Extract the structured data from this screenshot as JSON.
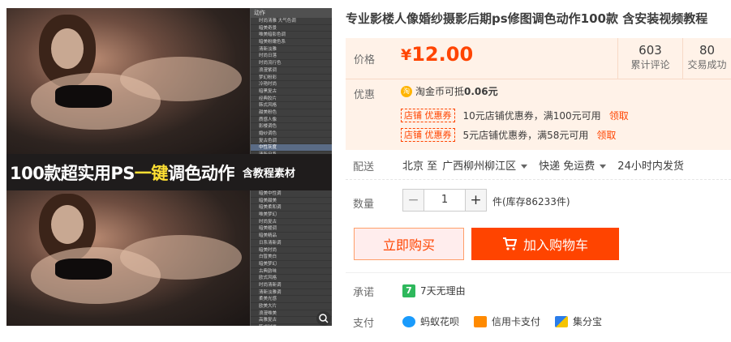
{
  "gallery": {
    "banner_prefix": "100款超实用PS",
    "banner_highlight": "一键",
    "banner_suffix": "调色动作",
    "banner_sub": "含教程素材",
    "panel_title": "动作",
    "panel_rows_top": [
      "时尚清雅 大气色调",
      "暗美奇景",
      "唯美暗影色调",
      "暗美粉嫩色系",
      "清新淡雅",
      "时尚日落",
      "时尚流行色",
      "浪漫紫调",
      "梦幻粉彩",
      "冷艳时尚",
      "暗黑复古",
      "经典胶片",
      "韩式风格",
      "甜美粉色",
      "质感人像",
      "影楼调色",
      "婚纱调色",
      "复古色调",
      "中性灰度",
      "清新日系",
      "时尚大片"
    ],
    "panel_rows_bot": [
      "暗美中性调",
      "暗美甜美",
      "暗美柔和调",
      "唯美梦幻",
      "时尚复古",
      "暗美暖调",
      "暗美精品",
      "日系清新调",
      "暗美时尚",
      "白皙美白",
      "暗美梦幻",
      "古典韵味",
      "欧式风格",
      "时尚清新调",
      "清新淡雅调",
      "柔美光感",
      "欧美大片",
      "浪漫唯美",
      "高雅复古",
      "韩式时尚"
    ],
    "selected_top_index": 18
  },
  "product": {
    "title": "专业影楼人像婚纱摄影后期ps修图调色动作100款 含安装视频教程"
  },
  "price": {
    "label": "价格",
    "currency": "¥",
    "amount": "12.00",
    "reviews_count": "603",
    "reviews_label": "累计评论",
    "sales_count": "80",
    "sales_label": "交易成功"
  },
  "promo": {
    "label": "优惠",
    "coin_badge": "淘",
    "coin_text": "淘金币可抵",
    "coin_value": "0.06元",
    "coupons": [
      {
        "tag": "店铺  优惠券",
        "text": "10元店铺优惠券，满100元可用",
        "claim": "领取"
      },
      {
        "tag": "店铺  优惠券",
        "text": "5元店铺优惠券，满58元可用",
        "claim": "领取"
      }
    ]
  },
  "shipping": {
    "label": "配送",
    "from": "北京 至",
    "to": "广西柳州柳江区",
    "method": "快递 免运费",
    "dispatch": "24小时内发货"
  },
  "quantity": {
    "label": "数量",
    "minus": "−",
    "value": "1",
    "plus": "+",
    "stock_text": "件(库存86233件)"
  },
  "actions": {
    "buy_now": "立即购买",
    "add_to_cart": "加入购物车"
  },
  "promise": {
    "label": "承诺",
    "badge": "7",
    "text": "7天无理由"
  },
  "payment": {
    "label": "支付",
    "methods": [
      "蚂蚁花呗",
      "信用卡支付",
      "集分宝"
    ]
  },
  "colors": {
    "accent": "#ff4400",
    "price_bg": "#fff2e8"
  }
}
